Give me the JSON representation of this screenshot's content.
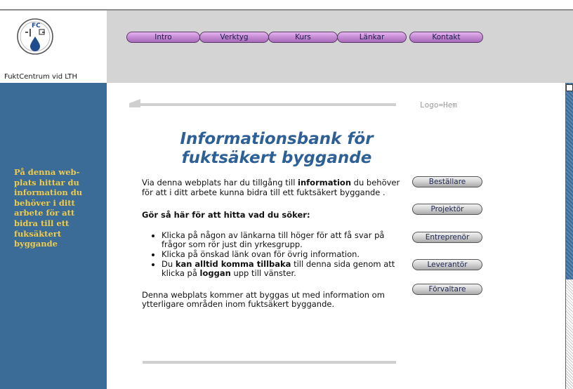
{
  "header": {
    "logo_text": "FuktCentrum vid LTH",
    "logo_badge": "FC",
    "nav": [
      {
        "label": "Intro"
      },
      {
        "label": "Verktyg"
      },
      {
        "label": "Kurs"
      },
      {
        "label": "Länkar"
      },
      {
        "label": "Kontakt"
      }
    ]
  },
  "sidebar": {
    "text": "På denna web-plats hittar du information du behöver i ditt arbete för att bidra till ett fuksäktert byggande"
  },
  "main": {
    "logo_hint": "Logo=Hem",
    "title": "Informationsbank för fuktsäkert byggande",
    "intro_before": "Via denna webplats har du tillgång till ",
    "intro_bold": "information",
    "intro_after": " du behöver för att i ditt arbete kunna bidra till ett fuktsäkert byggande .",
    "howto_heading": "Gör så här för att hitta vad du söker:",
    "steps": {
      "s1": "Klicka på någon av länkarna till höger för att få svar på frågor som rör just din yrkesgrupp.",
      "s2": "Klicka på önskad länk ovan för övrig information.",
      "s3_before": "Du ",
      "s3_bold1": "kan alltid komma tillbaka",
      "s3_mid": " till denna sida genom att klicka på ",
      "s3_bold2": "loggan",
      "s3_after": " upp till vänster."
    },
    "outro": "Denna webplats kommer att byggas ut med information om ytterligare områden inom fuktsäkert byggande."
  },
  "side_buttons": [
    {
      "label": "Beställare"
    },
    {
      "label": "Projektör"
    },
    {
      "label": "Entreprenör"
    },
    {
      "label": "Leverantör"
    },
    {
      "label": "Förvaltare"
    }
  ],
  "colors": {
    "sidebar": "#3b6b97",
    "sidebar_text": "#f0cc4a",
    "title": "#2e6096",
    "nav_button": "#c88fd6",
    "header_bg": "#d4d4d4"
  }
}
